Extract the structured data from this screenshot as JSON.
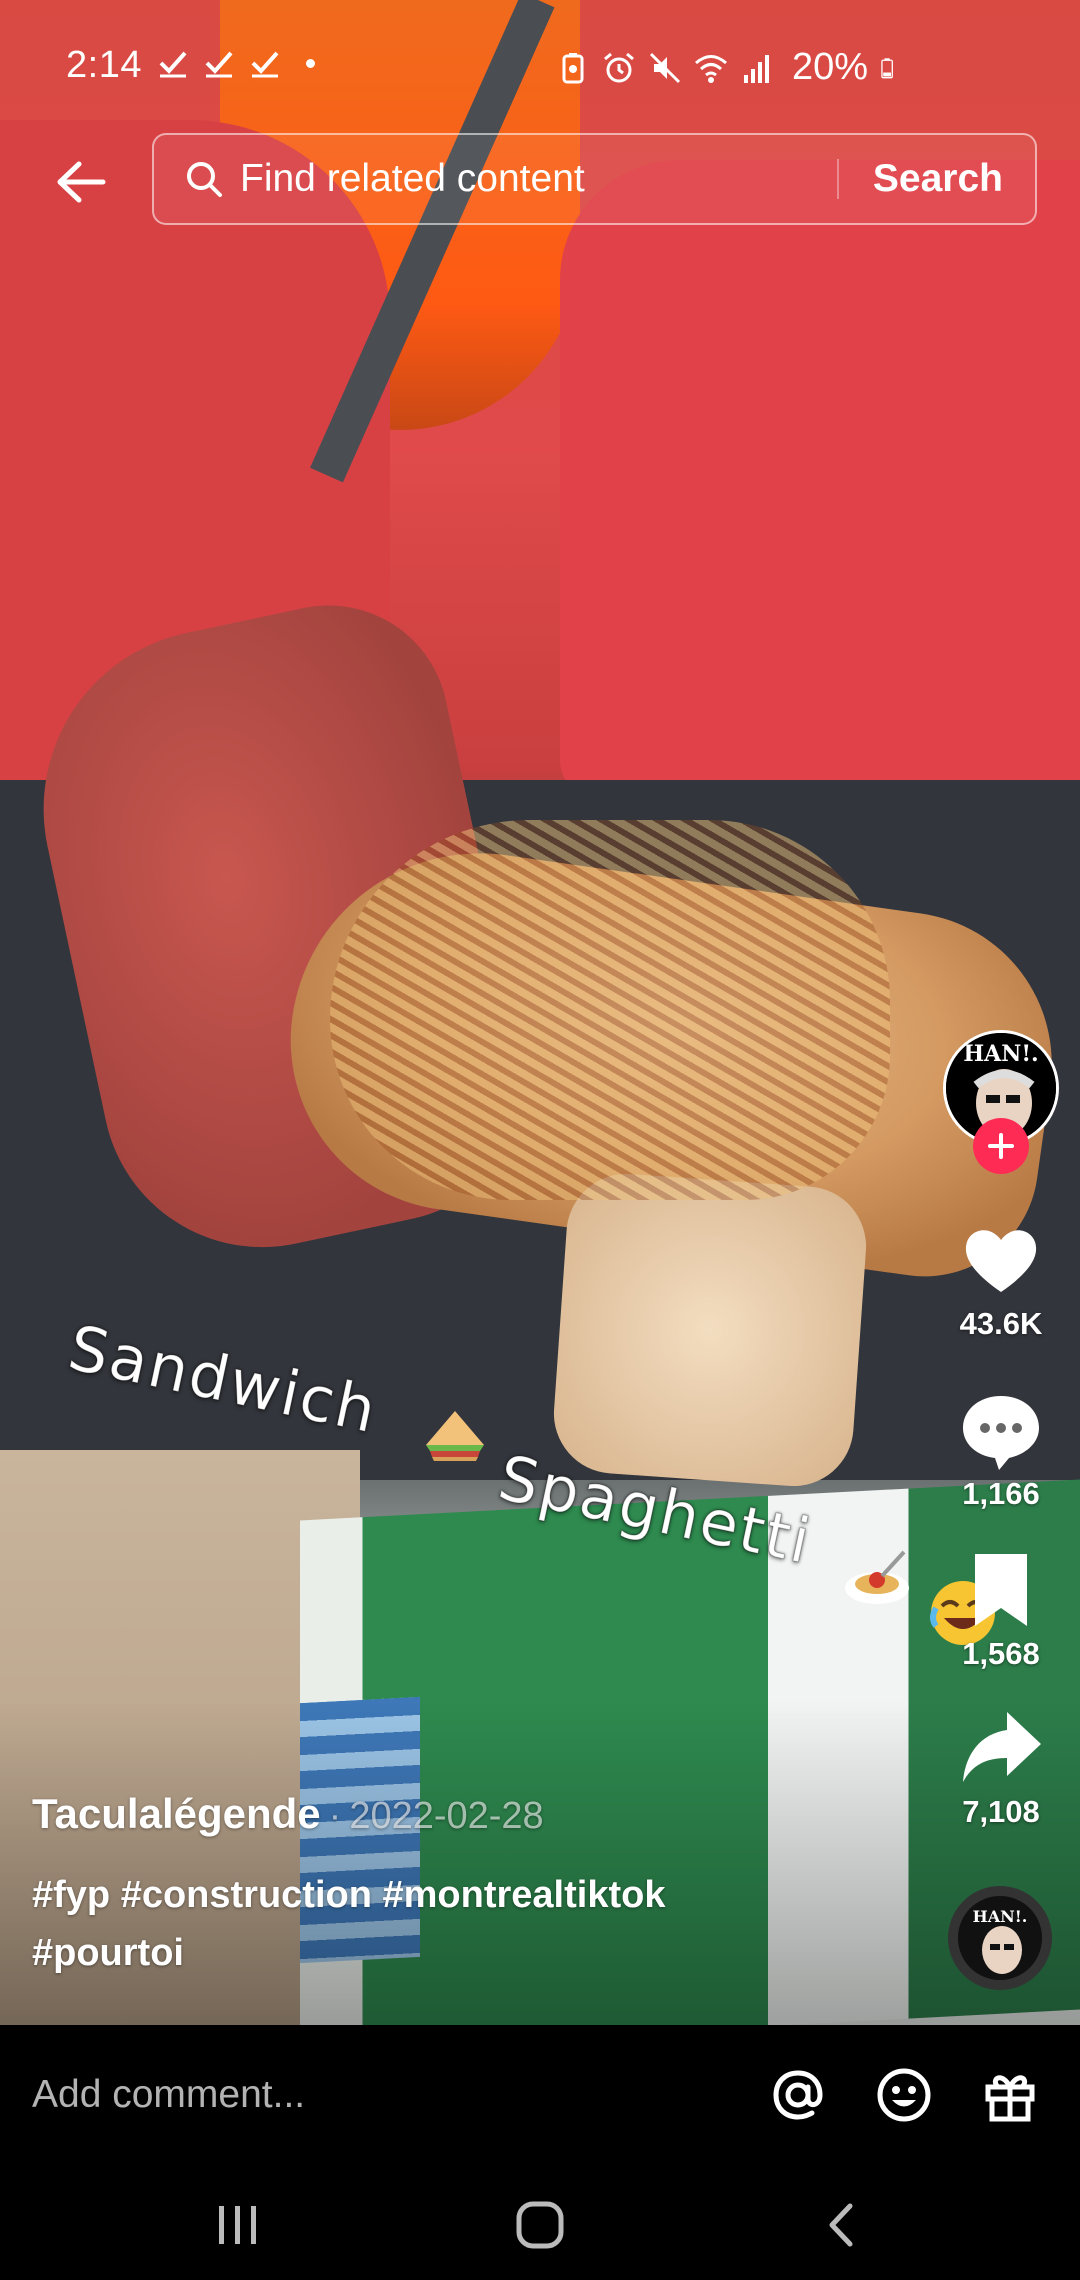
{
  "status_bar": {
    "time": "2:14",
    "battery_percent": "20%",
    "icons": [
      "check-icon",
      "check-icon",
      "check-icon",
      "dot-icon",
      "battery-saver-icon",
      "alarm-icon",
      "mute-icon",
      "wifi-icon",
      "signal-icon",
      "battery-icon"
    ]
  },
  "search": {
    "placeholder": "Find related content",
    "button_label": "Search"
  },
  "video_overlay": {
    "line1": "Sandwich",
    "line2": "Spaghetti"
  },
  "actions": {
    "likes": "43.6K",
    "comments": "1,166",
    "saves": "1,568",
    "shares": "7,108",
    "avatar_text": "HAN!."
  },
  "caption": {
    "author": "Taculalégende",
    "separator": "·",
    "date": "2022-02-28",
    "hashtags_line1": "#fyp #construction #montrealtiktok",
    "hashtags_line2": "#pourtoi"
  },
  "comment_bar": {
    "placeholder": "Add comment..."
  },
  "colors": {
    "follow_accent": "#fe2c55",
    "background": "#000000"
  }
}
